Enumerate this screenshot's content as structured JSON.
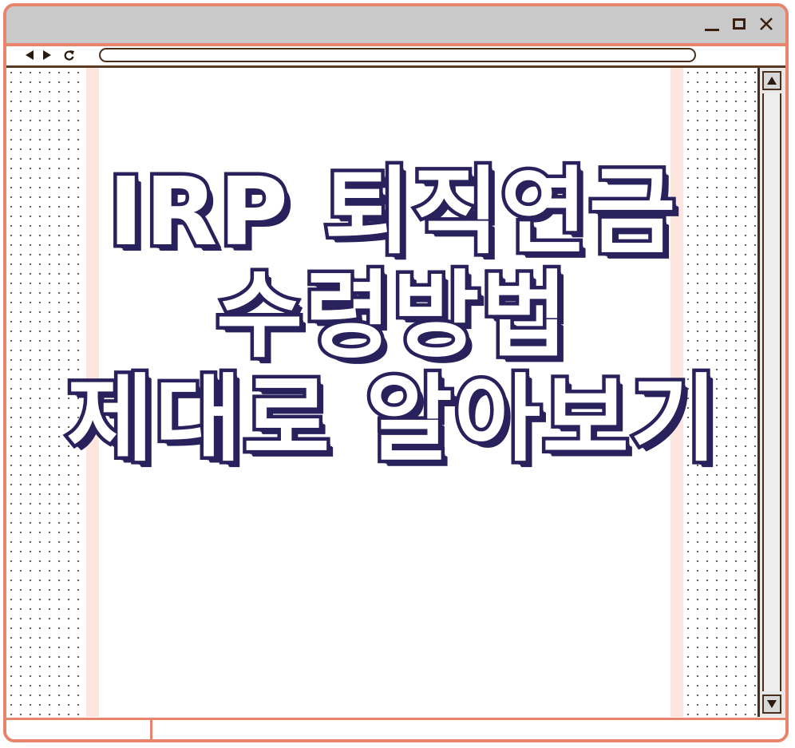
{
  "headline": {
    "line1": "IRP 퇴직연금",
    "line2": "수령방법",
    "line3": "제대로 알아보기"
  },
  "colors": {
    "frame": "#e8846b",
    "titlebar": "#c9c9c9",
    "text_fill": "#ffffff",
    "text_outline": "#28215c",
    "stripe": "#fde6de"
  },
  "icons": [
    "back-arrow-icon",
    "forward-arrow-icon",
    "reload-icon",
    "minimize-icon",
    "maximize-icon",
    "close-icon",
    "scroll-up-icon",
    "scroll-down-icon"
  ]
}
